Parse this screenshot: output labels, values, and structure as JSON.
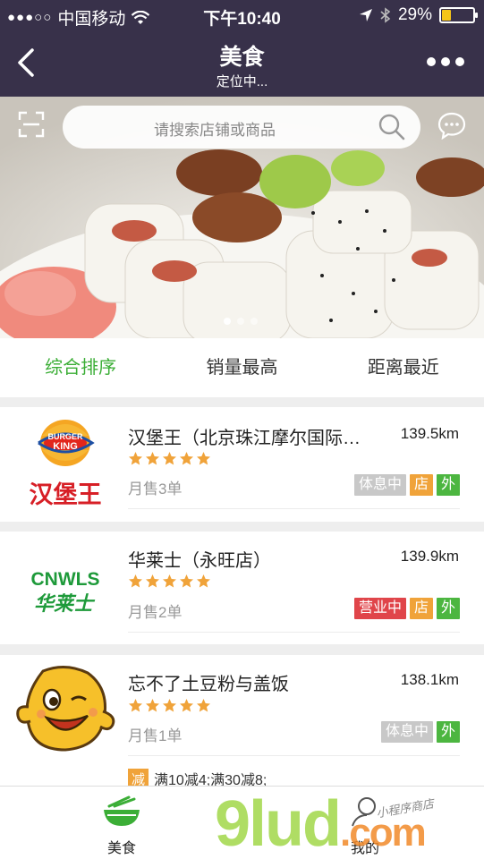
{
  "status_bar": {
    "carrier": "中国移动",
    "time": "下午10:40",
    "battery_percent": "29%",
    "battery_level": 0.29
  },
  "nav": {
    "title": "美食",
    "subtitle": "定位中..."
  },
  "search": {
    "placeholder": "请搜索店铺或商品"
  },
  "banner": {
    "pages": 3,
    "active_page": 1
  },
  "sort_tabs": [
    {
      "label": "综合排序",
      "active": true
    },
    {
      "label": "销量最高",
      "active": false
    },
    {
      "label": "距离最近",
      "active": false
    }
  ],
  "shops": [
    {
      "name": "汉堡王（北京珠江摩尔国际…",
      "distance": "139.5km",
      "rating": 5,
      "monthly_sales": "月售3单",
      "tags": [
        {
          "text": "体息中",
          "kind": "rest"
        },
        {
          "text": "店",
          "kind": "shop"
        },
        {
          "text": "外",
          "kind": "out"
        }
      ],
      "logo_icon": "burger-king-logo",
      "logo_text": "汉堡王",
      "logo_brand": "BURGER KING"
    },
    {
      "name": "华莱士（永旺店）",
      "distance": "139.9km",
      "rating": 5,
      "monthly_sales": "月售2单",
      "tags": [
        {
          "text": "营业中",
          "kind": "open"
        },
        {
          "text": "店",
          "kind": "shop"
        },
        {
          "text": "外",
          "kind": "out"
        }
      ],
      "logo_icon": "wallace-logo",
      "logo_text": "华莱士",
      "logo_brand": "CNWLS"
    },
    {
      "name": "忘不了土豆粉与盖饭",
      "distance": "138.1km",
      "rating": 5,
      "monthly_sales": "月售1单",
      "tags": [
        {
          "text": "体息中",
          "kind": "rest"
        },
        {
          "text": "外",
          "kind": "out"
        }
      ],
      "logo_icon": "potato-mascot-logo",
      "promo_badge": "减",
      "promo_text": "满10减4;满30减8;"
    }
  ],
  "tab_bar": {
    "food_label": "美食",
    "mine_label": "我的"
  },
  "watermark": {
    "main": "9lud",
    "suffix": ".com",
    "tagline": "小程序商店"
  },
  "colors": {
    "header_bg": "#38314a",
    "accent_green": "#3bae36",
    "star_orange": "#f0a33a",
    "tag_open": "#e0454a",
    "tag_rest": "#c8c8c8",
    "tag_shop": "#f0a33a",
    "tag_out": "#4cb640"
  }
}
